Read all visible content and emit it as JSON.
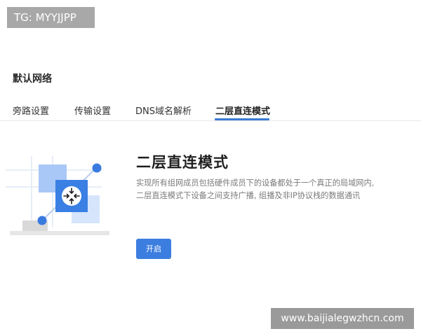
{
  "badge": {
    "text": "TG: MYYJJPP"
  },
  "page": {
    "title": "默认网络"
  },
  "tabs": [
    {
      "label": "旁路设置",
      "active": false
    },
    {
      "label": "传输设置",
      "active": false
    },
    {
      "label": "DNS域名解析",
      "active": false
    },
    {
      "label": "二层直连模式",
      "active": true
    }
  ],
  "content": {
    "title": "二层直连模式",
    "description_lines": [
      "实现所有组网成员包括硬件成员下的设备都处于一个真正的局域网内,",
      "二层直连模式下设备之间支持广播, 组播及非IP协议栈的数据通讯"
    ],
    "enable_label": "开启"
  },
  "watermark": {
    "text": "www.baijialegwzhcn.com"
  },
  "colors": {
    "accent": "#3a7bd5",
    "button": "#3c7ee0",
    "illustration_light_blue": "#c9dcfb",
    "illustration_mid_blue": "#a9c7f7",
    "illustration_icon_blue": "#3a7fe3",
    "illustration_dot": "#3a7be0"
  },
  "icons": {
    "illustration_icon": "router-arrows-icon"
  }
}
